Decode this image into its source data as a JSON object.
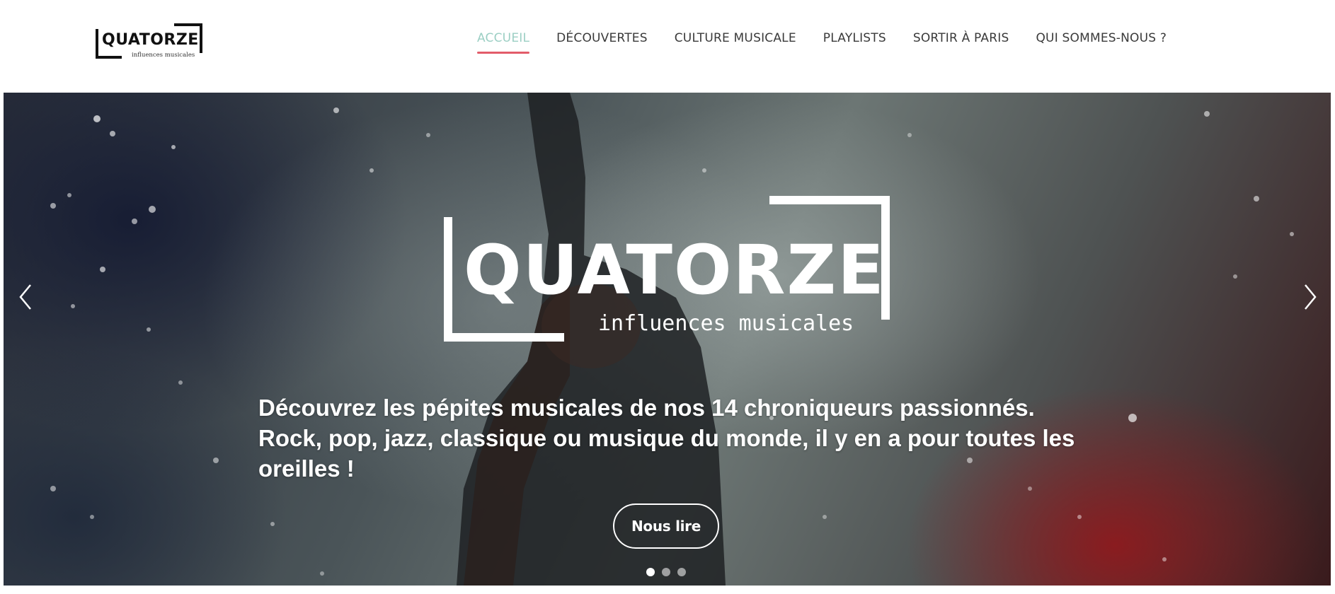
{
  "brand": {
    "name": "QUATORZE",
    "tagline": "influences musicales",
    "color": "#111111"
  },
  "nav": {
    "items": [
      {
        "label": "ACCUEIL",
        "active": true
      },
      {
        "label": "DÉCOUVERTES",
        "active": false
      },
      {
        "label": "CULTURE MUSICALE",
        "active": false
      },
      {
        "label": "PLAYLISTS",
        "active": false
      },
      {
        "label": "SORTIR À PARIS",
        "active": false
      },
      {
        "label": "QUI SOMMES-NOUS ?",
        "active": false
      }
    ],
    "active_color": "#9ccfc4",
    "underline_color": "#e25c6a"
  },
  "hero": {
    "logo_name": "QUATORZE",
    "logo_tagline": "influences musicales",
    "headline": "Découvrez les pépites musicales de nos 14 chroniqueurs passionnés. Rock, pop, jazz, classique ou musique du monde, il y en a pour toutes les oreilles !",
    "cta_label": "Nous lire",
    "prev_icon": "chevron-left-icon",
    "next_icon": "chevron-right-icon",
    "slides": [
      {
        "active": true
      },
      {
        "active": false
      },
      {
        "active": false
      }
    ]
  }
}
